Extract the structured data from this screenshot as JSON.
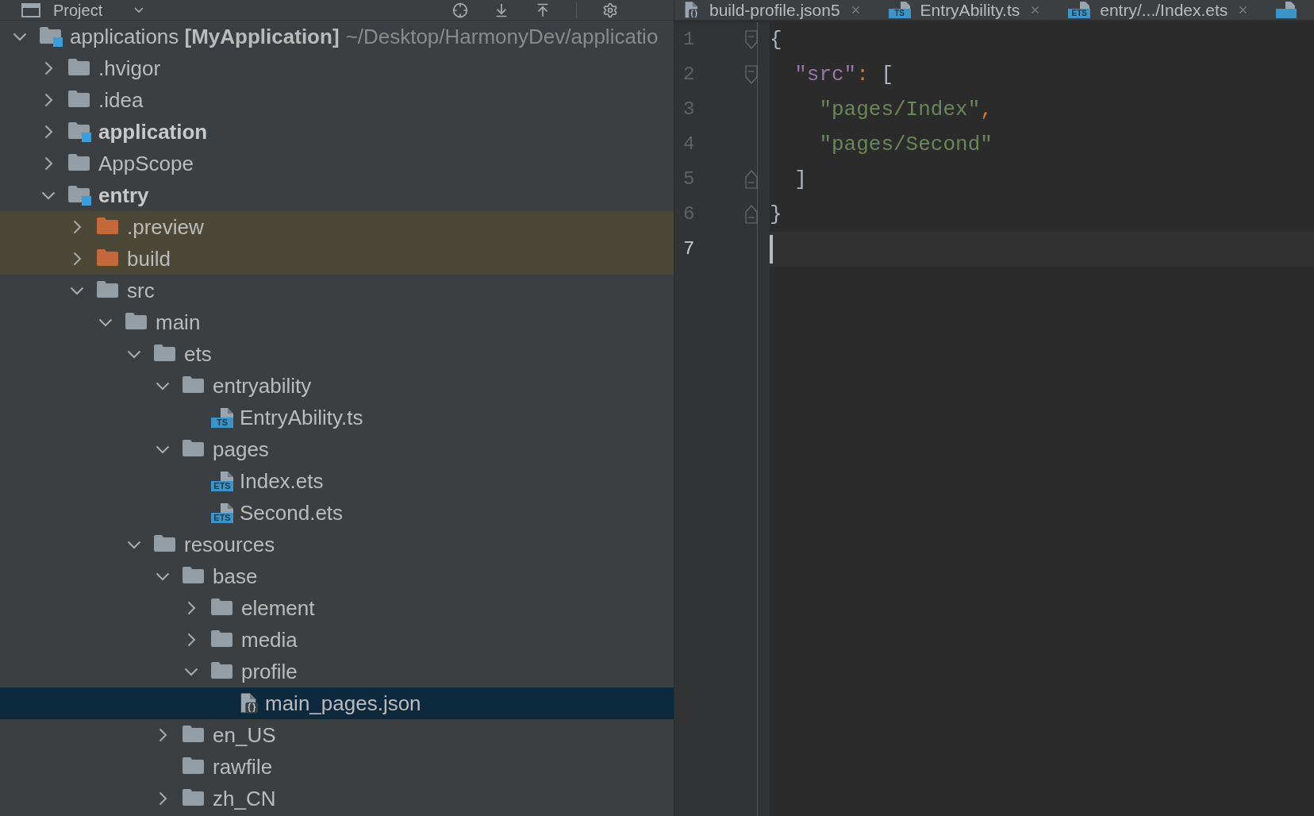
{
  "tool_window": {
    "title": "Project"
  },
  "project_tree": {
    "label": "applications **[MyApplication]**",
    "path": "~/Desktop/HarmonyDev/applicatio",
    "kind": "project",
    "expanded": true,
    "selected": false,
    "children": [
      {
        "label": ".hvigor",
        "kind": "folder",
        "expanded": false,
        "selected": false
      },
      {
        "label": ".idea",
        "kind": "folder",
        "expanded": false,
        "selected": false
      },
      {
        "label": "application",
        "kind": "module",
        "expanded": false,
        "selected": false
      },
      {
        "label": "AppScope",
        "kind": "folder",
        "expanded": false,
        "selected": false
      },
      {
        "label": "entry",
        "kind": "module",
        "expanded": true,
        "selected": false,
        "children": [
          {
            "label": ".preview",
            "kind": "excluded",
            "expanded": false,
            "selected": false
          },
          {
            "label": "build",
            "kind": "excluded",
            "expanded": false,
            "selected": false
          },
          {
            "label": "src",
            "kind": "folder",
            "expanded": true,
            "selected": false,
            "children": [
              {
                "label": "main",
                "kind": "folder",
                "expanded": true,
                "selected": false,
                "children": [
                  {
                    "label": "ets",
                    "kind": "folder",
                    "expanded": true,
                    "selected": false,
                    "children": [
                      {
                        "label": "entryability",
                        "kind": "folder",
                        "expanded": true,
                        "selected": false,
                        "children": [
                          {
                            "label": "EntryAbility.ts",
                            "kind": "ts",
                            "badge": "TS",
                            "selected": false
                          }
                        ]
                      },
                      {
                        "label": "pages",
                        "kind": "folder",
                        "expanded": true,
                        "selected": false,
                        "children": [
                          {
                            "label": "Index.ets",
                            "kind": "ets",
                            "badge": "ETS",
                            "selected": false
                          },
                          {
                            "label": "Second.ets",
                            "kind": "ets",
                            "badge": "ETS",
                            "selected": false
                          }
                        ]
                      }
                    ]
                  },
                  {
                    "label": "resources",
                    "kind": "folder",
                    "expanded": true,
                    "selected": false,
                    "children": [
                      {
                        "label": "base",
                        "kind": "folder",
                        "expanded": true,
                        "selected": false,
                        "children": [
                          {
                            "label": "element",
                            "kind": "folder",
                            "expanded": false,
                            "selected": false
                          },
                          {
                            "label": "media",
                            "kind": "folder",
                            "expanded": false,
                            "selected": false
                          },
                          {
                            "label": "profile",
                            "kind": "folder",
                            "expanded": true,
                            "selected": false,
                            "children": [
                              {
                                "label": "main_pages.json",
                                "kind": "json",
                                "selected": true
                              }
                            ]
                          }
                        ]
                      },
                      {
                        "label": "en_US",
                        "kind": "folder",
                        "expanded": false,
                        "selected": false
                      },
                      {
                        "label": "rawfile",
                        "kind": "folder",
                        "selected": false
                      },
                      {
                        "label": "zh_CN",
                        "kind": "folder",
                        "expanded": false,
                        "selected": false
                      }
                    ]
                  }
                ]
              }
            ]
          }
        ]
      }
    ]
  },
  "editor": {
    "tabs": [
      {
        "label": "build-profile.json5",
        "kind": "json",
        "selected": false
      },
      {
        "label": "EntryAbility.ts",
        "kind": "ts",
        "badge": "TS",
        "selected": false
      },
      {
        "label": "entry/.../Index.ets",
        "kind": "ets",
        "badge": "ETS",
        "selected": false
      },
      {
        "kind": "ets",
        "selected": false
      }
    ],
    "lines": [
      {
        "number": "1",
        "kind": "open",
        "current": false,
        "tokens": [
          {
            "kind": "bracket",
            "text": "{"
          }
        ],
        "children": [
          {
            "number": "2",
            "kind": "open",
            "current": false,
            "tokens": [
              {
                "kind": "key",
                "text": "\"src\""
              },
              {
                "kind": "punct",
                "text": ": "
              },
              {
                "kind": "bracket",
                "text": "["
              }
            ],
            "children": [
              {
                "number": "3",
                "current": false,
                "tokens": [
                  {
                    "kind": "string",
                    "text": "\"pages/Index\""
                  },
                  {
                    "kind": "punct",
                    "text": ","
                  }
                ]
              },
              {
                "number": "4",
                "current": false,
                "tokens": [
                  {
                    "kind": "string",
                    "text": "\"pages/Second\""
                  }
                ]
              }
            ]
          },
          {
            "number": "5",
            "kind": "close",
            "current": false,
            "tokens": [
              {
                "kind": "bracket",
                "text": "]"
              }
            ]
          }
        ]
      },
      {
        "number": "6",
        "kind": "close",
        "current": false,
        "tokens": [
          {
            "kind": "bracket",
            "text": "}"
          }
        ]
      },
      {
        "number": "7",
        "current": true
      }
    ]
  }
}
